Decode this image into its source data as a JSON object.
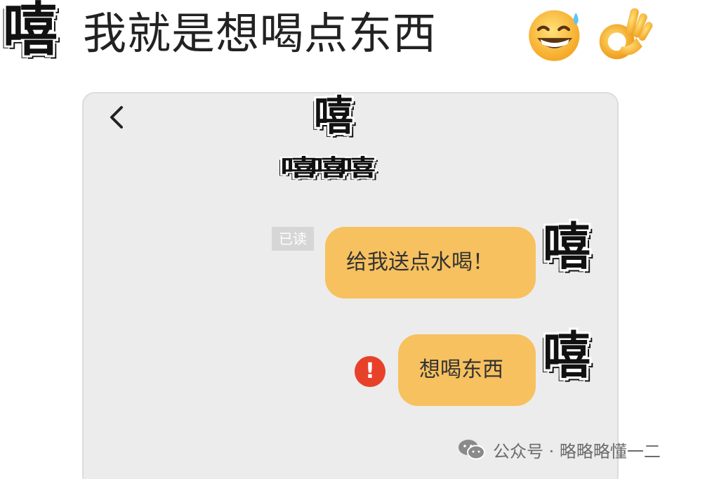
{
  "caption": {
    "prefix_glyph": "嘻",
    "text": "我就是想喝点东西"
  },
  "chat": {
    "back_icon": "chevron-left-icon",
    "title_glyph": "嘻",
    "subtitle_glyphs": "嘻嘻嘻",
    "read_status": "已读",
    "messages": [
      {
        "text": "给我送点水喝！",
        "avatar_glyph": "嘻"
      },
      {
        "text": "想喝东西",
        "avatar_glyph": "嘻",
        "error": "!"
      }
    ]
  },
  "watermark": {
    "icon": "wechat-icon",
    "text": "公众号 · 略略略懂一二"
  },
  "colors": {
    "bubble": "#f7c15f",
    "error": "#e8412a",
    "phone_bg": "#ececec"
  }
}
